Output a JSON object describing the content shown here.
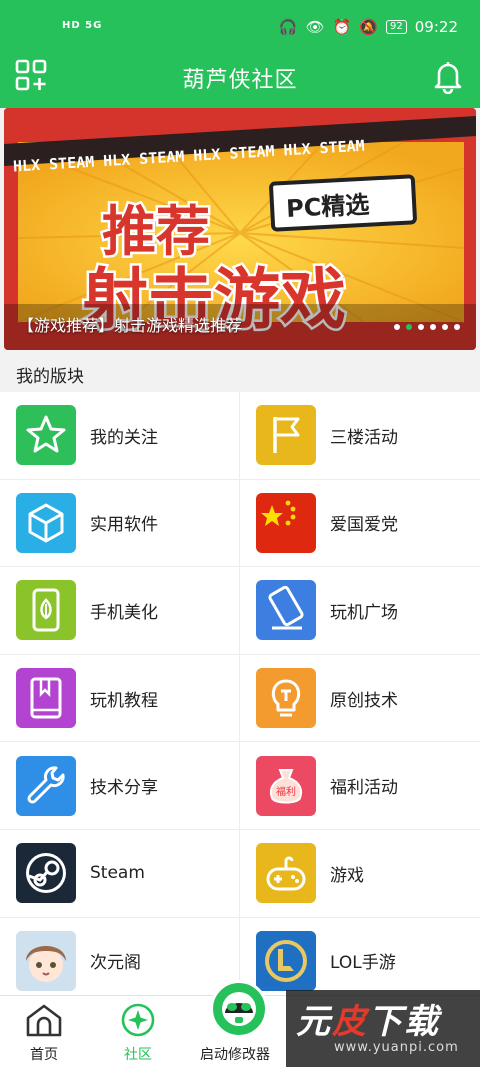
{
  "status_bar": {
    "left": "HD 5G",
    "battery": "92",
    "time": "09:22"
  },
  "header": {
    "title": "葫芦侠社区"
  },
  "banner": {
    "caption": "【游戏推荐】射击游戏精选推荐",
    "strip_text": "HLX STEAM  HLX STEAM  HLX STEAM  HLX STEAM",
    "tag": "PC精选",
    "line1": "推荐",
    "line2": "射击游戏",
    "dots": 6,
    "active_dot": 1
  },
  "section": {
    "title": "我的版块"
  },
  "boards": [
    {
      "label": "我的关注",
      "icon": "star-icon",
      "color": "#2fbf5a"
    },
    {
      "label": "三楼活动",
      "icon": "flag-icon",
      "color": "#e7b71c"
    },
    {
      "label": "实用软件",
      "icon": "cube-icon",
      "color": "#2aaee6"
    },
    {
      "label": "爱国爱党",
      "icon": "china-flag-icon",
      "color": "#de2910"
    },
    {
      "label": "手机美化",
      "icon": "phone-beautify-icon",
      "color": "#8bc42a"
    },
    {
      "label": "玩机广场",
      "icon": "phone-square-icon",
      "color": "#3d7fe0"
    },
    {
      "label": "玩机教程",
      "icon": "book-icon",
      "color": "#b343d1"
    },
    {
      "label": "原创技术",
      "icon": "bulb-icon",
      "color": "#f39b2f"
    },
    {
      "label": "技术分享",
      "icon": "wrench-icon",
      "color": "#2f8fe6"
    },
    {
      "label": "福利活动",
      "icon": "gift-bag-icon",
      "color": "#ec4a63"
    },
    {
      "label": "Steam",
      "icon": "steam-icon",
      "color": "#1b2838"
    },
    {
      "label": "游戏",
      "icon": "gamepad-icon",
      "color": "#e7b71c"
    },
    {
      "label": "次元阁",
      "icon": "anime-avatar-icon",
      "color": "#c8d8e8"
    },
    {
      "label": "LOL手游",
      "icon": "lol-icon",
      "color": "#1f6fc2"
    }
  ],
  "tabs": [
    {
      "label": "首页",
      "icon": "home-icon"
    },
    {
      "label": "社区",
      "icon": "community-icon"
    },
    {
      "label": "启动修改器",
      "icon": "launcher-icon"
    }
  ],
  "watermark": {
    "main_a": "元",
    "main_b": "皮",
    "main_c": "下载",
    "sub": "www.yuanpi.com"
  },
  "colors": {
    "brand": "#26c15a"
  }
}
